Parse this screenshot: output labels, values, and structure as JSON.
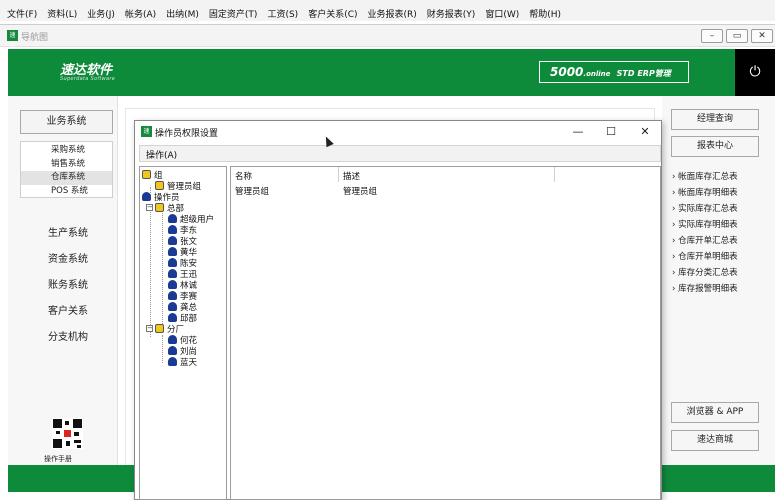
{
  "menubar": {
    "items": [
      "文件(F)",
      "资料(L)",
      "业务(J)",
      "帐务(A)",
      "出纳(M)",
      "固定资产(T)",
      "工资(S)",
      "客户关系(C)",
      "业务报表(R)",
      "财务报表(Y)",
      "窗口(W)",
      "帮助(H)"
    ]
  },
  "outer_window": {
    "title": "导航图",
    "icon_text": "速达",
    "controls": [
      "minimize-icon",
      "restore-icon",
      "close-icon"
    ]
  },
  "banner": {
    "logo": "速达软件",
    "logo_sub": "Superdata Software",
    "product_big": "5000",
    "product_small": ".online",
    "product_rest": "STD  ERP管理",
    "power_icon": "power-icon"
  },
  "leftnav": {
    "business_button": "业务系统",
    "sub_items": [
      "采购系统",
      "销售系统",
      "仓库系统",
      "POS 系统"
    ],
    "active_sub_item": "仓库系统",
    "links": [
      "生产系统",
      "资金系统",
      "账务系统",
      "客户关系",
      "分支机构"
    ],
    "qr_label": "操作手册"
  },
  "rightnav": {
    "buttons_top": [
      "经理查询",
      "报表中心"
    ],
    "links": [
      "帐面库存汇总表",
      "帐面库存明细表",
      "实际库存汇总表",
      "实际库存明细表",
      "仓库开单汇总表",
      "仓库开单明细表",
      "库存分类汇总表",
      "库存报警明细表"
    ],
    "buttons_bottom": [
      "浏览器 & APP",
      "速达商城"
    ]
  },
  "dialog": {
    "title": "操作员权限设置",
    "icon_text": "速达",
    "toolbar_button": "操作(A)",
    "tree": {
      "group_root": "组",
      "admin_group": "管理员组",
      "operator_root": "操作员",
      "hq": "总部",
      "hq_members": [
        "超级用户",
        "李东",
        "张文",
        "黄华",
        "陈安",
        "王迅",
        "林诚",
        "李赛",
        "龚总",
        "邱部"
      ],
      "branch": "分厂",
      "branch_members": [
        "何花",
        "刘尚",
        "蓝天"
      ]
    },
    "list": {
      "columns": [
        "名称",
        "描述"
      ],
      "rows": [
        {
          "name": "管理员组",
          "desc": "管理员组"
        }
      ]
    }
  }
}
